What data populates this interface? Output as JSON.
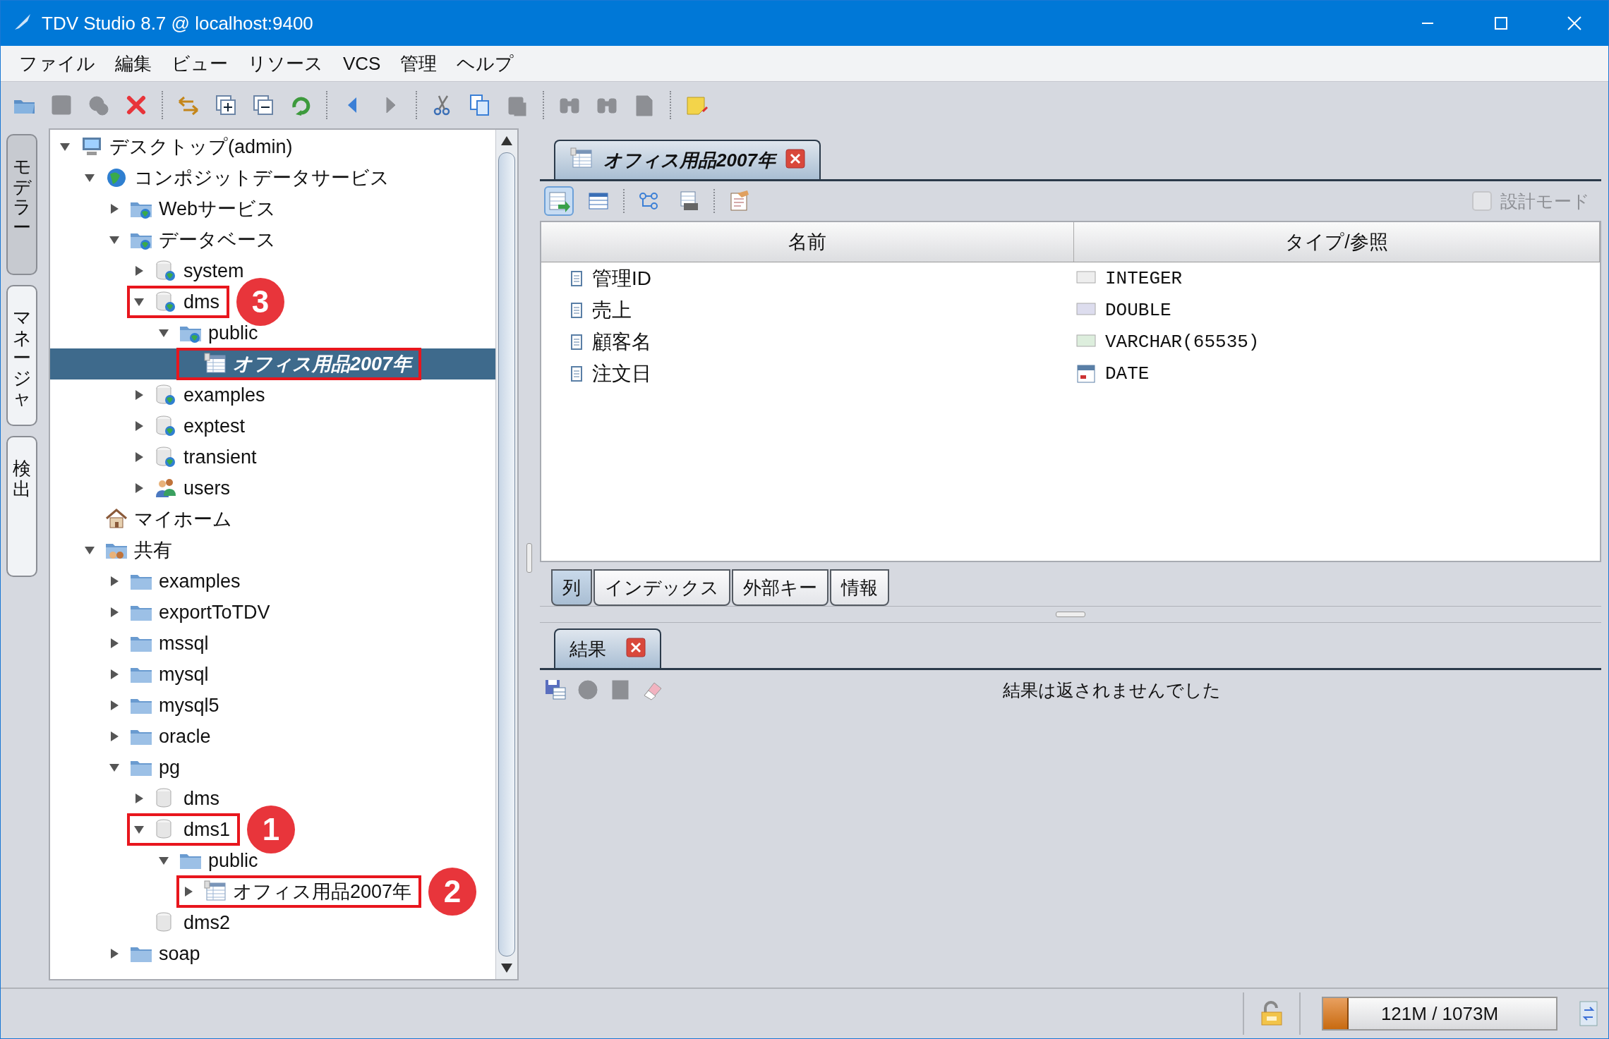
{
  "window": {
    "title": "TDV Studio 8.7 @ localhost:9400"
  },
  "menu": [
    "ファイル",
    "編集",
    "ビュー",
    "リソース",
    "VCS",
    "管理",
    "ヘルプ"
  ],
  "toolbar": [
    [
      {
        "disabled": false
      },
      {
        "disabled": true
      },
      {
        "disabled": true
      },
      {
        "disabled": false
      }
    ],
    [
      {
        "disabled": false
      },
      {
        "disabled": false
      },
      {
        "disabled": false
      },
      {
        "disabled": false
      }
    ],
    [
      {
        "disabled": false
      },
      {
        "disabled": true
      }
    ],
    [
      {
        "disabled": false
      },
      {
        "disabled": false
      },
      {
        "disabled": true
      }
    ],
    [
      {
        "disabled": true
      },
      {
        "disabled": true
      },
      {
        "disabled": true
      }
    ],
    [
      {
        "disabled": false
      }
    ]
  ],
  "side_tabs": [
    {
      "label": "モデラー",
      "selected": true
    },
    {
      "label": "マネージャ",
      "selected": false
    },
    {
      "label": "検出",
      "selected": false
    }
  ],
  "tree": [
    {
      "label": "デスクトップ(admin)",
      "kind": "computer",
      "expanded": true,
      "selected": false,
      "children": [
        {
          "label": "コンポジットデータサービス",
          "kind": "globe",
          "expanded": true,
          "selected": false,
          "children": [
            {
              "label": "Webサービス",
              "kind": "folder-globe",
              "expanded": false,
              "selected": false
            },
            {
              "label": "データベース",
              "kind": "folder-globe",
              "expanded": true,
              "selected": false,
              "children": [
                {
                  "label": "system",
                  "kind": "db-globe",
                  "expanded": false,
                  "selected": false
                },
                {
                  "label": "dms",
                  "kind": "db-globe",
                  "expanded": true,
                  "selected": false,
                  "boxed": true,
                  "badge": "3",
                  "children": [
                    {
                      "label": "public",
                      "kind": "folder-globe",
                      "expanded": true,
                      "selected": false,
                      "children": [
                        {
                          "label": "オフィス用品2007年",
                          "kind": "table",
                          "selected": true,
                          "boxed": true
                        }
                      ]
                    }
                  ]
                },
                {
                  "label": "examples",
                  "kind": "db-globe",
                  "expanded": false,
                  "selected": false
                },
                {
                  "label": "exptest",
                  "kind": "db-globe",
                  "expanded": false,
                  "selected": false
                },
                {
                  "label": "transient",
                  "kind": "db-globe",
                  "expanded": false,
                  "selected": false
                },
                {
                  "label": "users",
                  "kind": "users",
                  "expanded": false,
                  "selected": false
                }
              ]
            }
          ]
        },
        {
          "label": "マイホーム",
          "kind": "home",
          "selected": false
        },
        {
          "label": "共有",
          "kind": "shared",
          "expanded": true,
          "selected": false,
          "children": [
            {
              "label": "examples",
              "kind": "folder",
              "expanded": false,
              "selected": false
            },
            {
              "label": "exportToTDV",
              "kind": "folder",
              "expanded": false,
              "selected": false
            },
            {
              "label": "mssql",
              "kind": "folder",
              "expanded": false,
              "selected": false
            },
            {
              "label": "mysql",
              "kind": "folder",
              "expanded": false,
              "selected": false
            },
            {
              "label": "mysql5",
              "kind": "folder",
              "expanded": false,
              "selected": false
            },
            {
              "label": "oracle",
              "kind": "folder",
              "expanded": false,
              "selected": false
            },
            {
              "label": "pg",
              "kind": "folder",
              "expanded": true,
              "selected": false,
              "children": [
                {
                  "label": "dms",
                  "kind": "db",
                  "expanded": false,
                  "selected": false
                },
                {
                  "label": "dms1",
                  "kind": "db",
                  "expanded": true,
                  "selected": false,
                  "boxed": true,
                  "badge": "1",
                  "children": [
                    {
                      "label": "public",
                      "kind": "folder",
                      "expanded": true,
                      "selected": false,
                      "children": [
                        {
                          "label": "オフィス用品2007年",
                          "kind": "table",
                          "expanded": false,
                          "selected": false,
                          "boxed": true,
                          "badge": "2"
                        }
                      ]
                    }
                  ]
                },
                {
                  "label": "dms2",
                  "kind": "db",
                  "selected": false
                }
              ]
            },
            {
              "label": "soap",
              "kind": "folder",
              "expanded": false,
              "selected": false
            }
          ]
        }
      ]
    }
  ],
  "editor": {
    "tab": {
      "label": "オフィス用品2007年"
    },
    "toolbar": [
      {
        "selected": true
      },
      {
        "selected": false
      },
      {
        "selected": false
      },
      {
        "selected": false
      },
      {
        "selected": false
      }
    ],
    "design_mode": {
      "label": "設計モード",
      "checked": false,
      "disabled": true
    },
    "table": {
      "columns": [
        "名前",
        "タイプ/参照"
      ],
      "rows": [
        {
          "name": "管理ID",
          "type": "INTEGER",
          "kind": "integer"
        },
        {
          "name": "売上",
          "type": "DOUBLE",
          "kind": "double"
        },
        {
          "name": "顧客名",
          "type": "VARCHAR(65535)",
          "kind": "varchar"
        },
        {
          "name": "注文日",
          "type": "DATE",
          "kind": "date"
        }
      ]
    },
    "bottom_tabs": [
      {
        "label": "列",
        "selected": true
      },
      {
        "label": "インデックス",
        "selected": false
      },
      {
        "label": "外部キー",
        "selected": false
      },
      {
        "label": "情報",
        "selected": false
      }
    ]
  },
  "results": {
    "tab": {
      "label": "結果"
    },
    "toolbar": [
      {
        "disabled": false
      },
      {
        "disabled": true
      },
      {
        "disabled": true
      },
      {
        "disabled": false
      }
    ],
    "message": "結果は返されませんでした"
  },
  "status_bar": {
    "memory": {
      "level": 0.11,
      "reading": "121M / 1073M"
    }
  }
}
